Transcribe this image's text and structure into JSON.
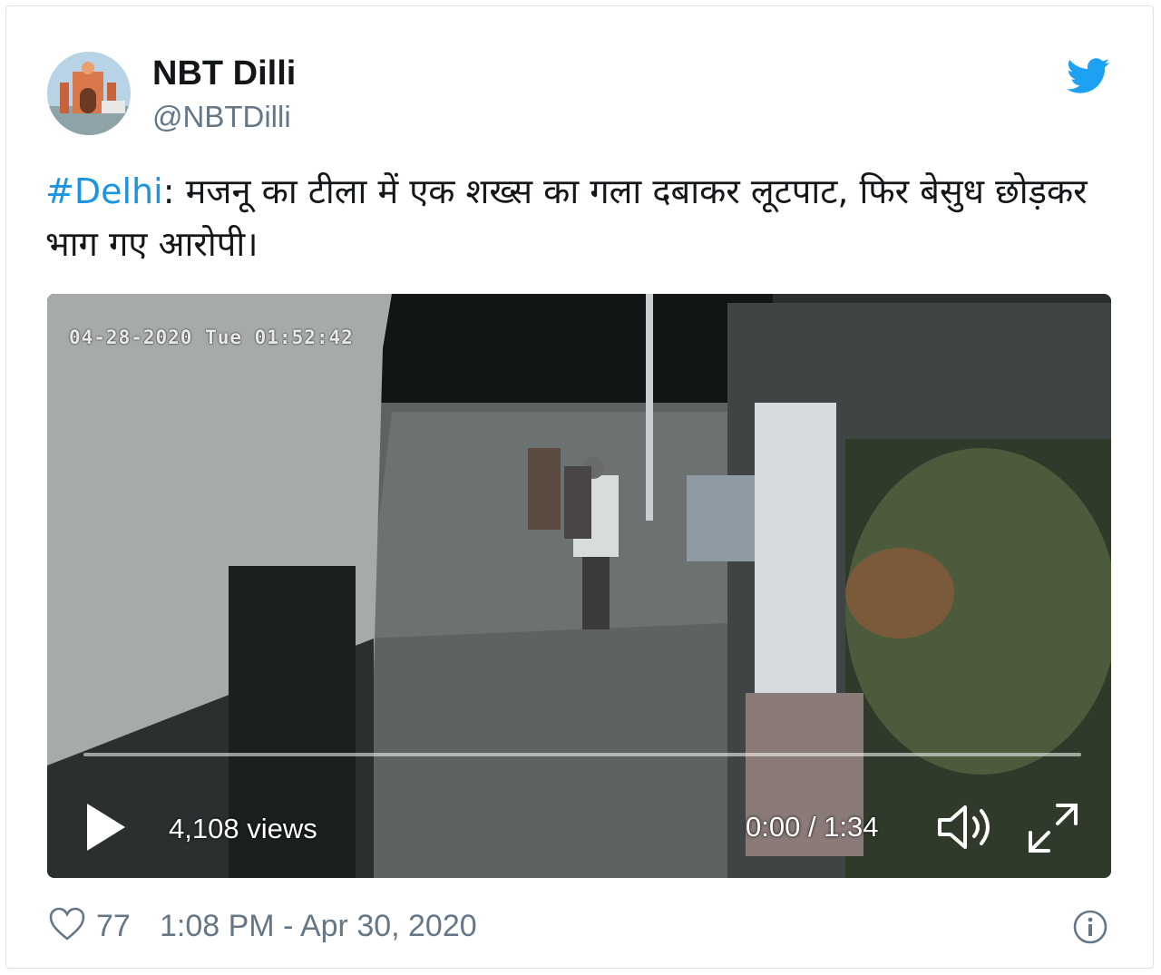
{
  "user": {
    "name": "NBT Dilli",
    "handle": "@NBTDilli"
  },
  "tweet": {
    "hashtag": "#Delhi",
    "text": ": मजनू का टीला में एक शख्स का गला दबाकर लूटपाट, फिर बेसुध छोड़कर भाग गए आरोपी।"
  },
  "video": {
    "cctv_timestamp": "04-28-2020 Tue 01:52:42",
    "views": "4,108 views",
    "time": "0:00 / 1:34",
    "progress": 0
  },
  "footer": {
    "likes": "77",
    "datetime": "1:08 PM - Apr 30, 2020"
  },
  "colors": {
    "link": "#1b95e0",
    "twitter_blue": "#1da1f2",
    "muted": "#657786"
  },
  "icons": [
    "twitter-bird-icon",
    "play-icon",
    "volume-icon",
    "fullscreen-icon",
    "heart-icon",
    "info-icon"
  ]
}
